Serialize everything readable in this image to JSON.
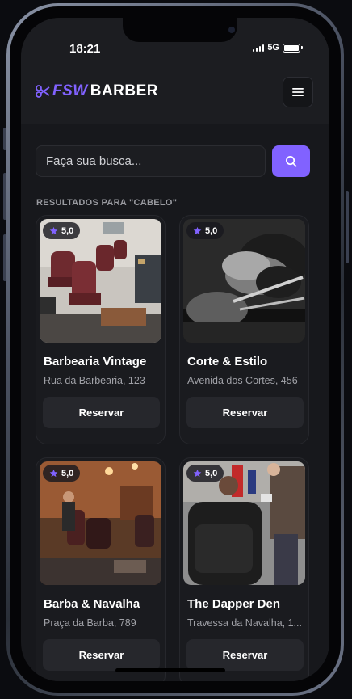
{
  "status_bar": {
    "time": "18:21",
    "network": "5G"
  },
  "header": {
    "logo_mark": "FSW",
    "logo_text": "BARBER"
  },
  "search": {
    "placeholder": "Faça sua busca...",
    "value": ""
  },
  "results": {
    "heading": "RESULTADOS PARA \"CABELO\"",
    "cards": [
      {
        "rating": "5,0",
        "name": "Barbearia Vintage",
        "address": "Rua da Barbearia, 123",
        "button": "Reservar"
      },
      {
        "rating": "5,0",
        "name": "Corte & Estilo",
        "address": "Avenida dos Cortes, 456",
        "button": "Reservar"
      },
      {
        "rating": "5,0",
        "name": "Barba & Navalha",
        "address": "Praça da Barba, 789",
        "button": "Reservar"
      },
      {
        "rating": "5,0",
        "name": "The Dapper Den",
        "address": "Travessa da Navalha, 1...",
        "button": "Reservar"
      }
    ]
  },
  "icons": {
    "menu": "menu-icon",
    "search": "search-icon",
    "star": "star-icon",
    "scissors": "scissors-icon"
  },
  "colors": {
    "accent": "#8162ff",
    "background": "#17181c",
    "card": "#1a1b1f",
    "button": "#26272c"
  }
}
